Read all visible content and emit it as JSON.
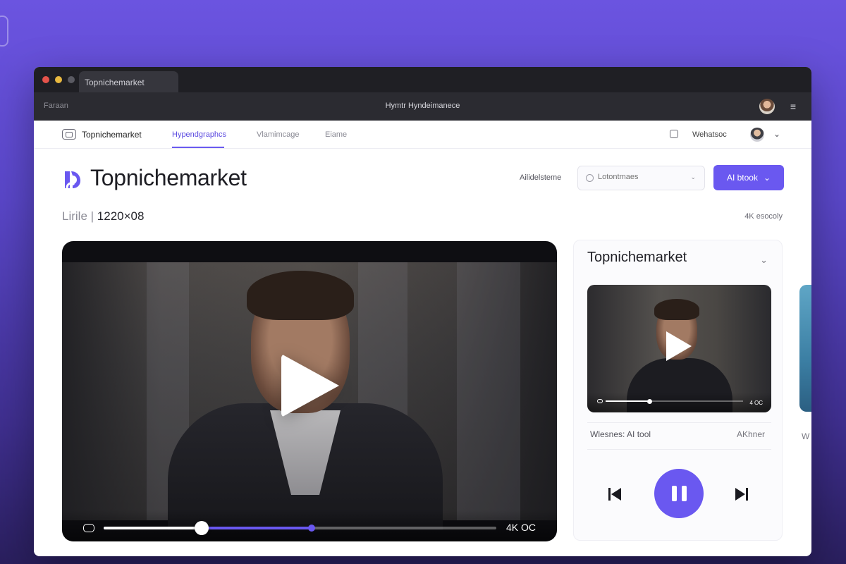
{
  "browser": {
    "tab_title": "Topnichemarket",
    "address_left": "Faraan",
    "address_center": "Hymtr Hyndeimanece"
  },
  "nav": {
    "brand": "Topnichemarket",
    "links": [
      "Hypendgraphcs",
      "Vlamimcage",
      "Eiame"
    ],
    "active_index": 0,
    "right_label": "Wehatsoc"
  },
  "hero": {
    "title": "Topnichemarket",
    "right_label": "Ailidelsteme",
    "search_placeholder": "Lotontmaes",
    "ai_button_label": "AI btook",
    "ai_button_chevron": "⌄",
    "resolution_prefix": "Lirile |",
    "resolution_value": "1220×08",
    "quality_label": "4K esocoly",
    "accent_color": "#6a58f0"
  },
  "player": {
    "quality_text": "4K OC",
    "progress_played": 0.25,
    "progress_buffered": 0.53
  },
  "side_panel": {
    "title": "Topnichemarket",
    "thumb_quality": "4 OC",
    "thumb_progress": 0.32,
    "caption_left": "Wlesnes: AI tool",
    "caption_right": "AKhner"
  },
  "peek": {
    "text": "W"
  }
}
